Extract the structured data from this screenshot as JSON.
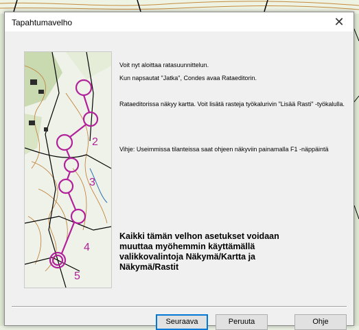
{
  "window": {
    "title": "Tapahtumavelho"
  },
  "content": {
    "line1": "Voit nyt aloittaa ratasuunnittelun.",
    "line2": "Kun napsautat \"Jatka\", Condes avaa Rataeditorin.",
    "line3": "Rataeditorissa näkyy kartta. Voit lisätä rasteja työkalurivin \"Lisää Rasti\" -työkalulla.",
    "line4": "Vihje: Useimmissa tilanteissa saat ohjeen näkyviin painamalla F1 -näppäintä",
    "note": "Kaikki tämän velhon asetukset voidaan muuttaa myöhemmin käyttämällä valikkovalintoja Näkymä/Kartta ja Näkymä/Rastit"
  },
  "buttons": {
    "next": "Seuraava",
    "cancel": "Peruuta",
    "help": "Ohje"
  },
  "image_labels": {
    "num2": "2",
    "num3": "3",
    "num4": "4",
    "num5": "5"
  },
  "colors": {
    "course": "#b0219a",
    "map_bg": "#eef2e8"
  }
}
